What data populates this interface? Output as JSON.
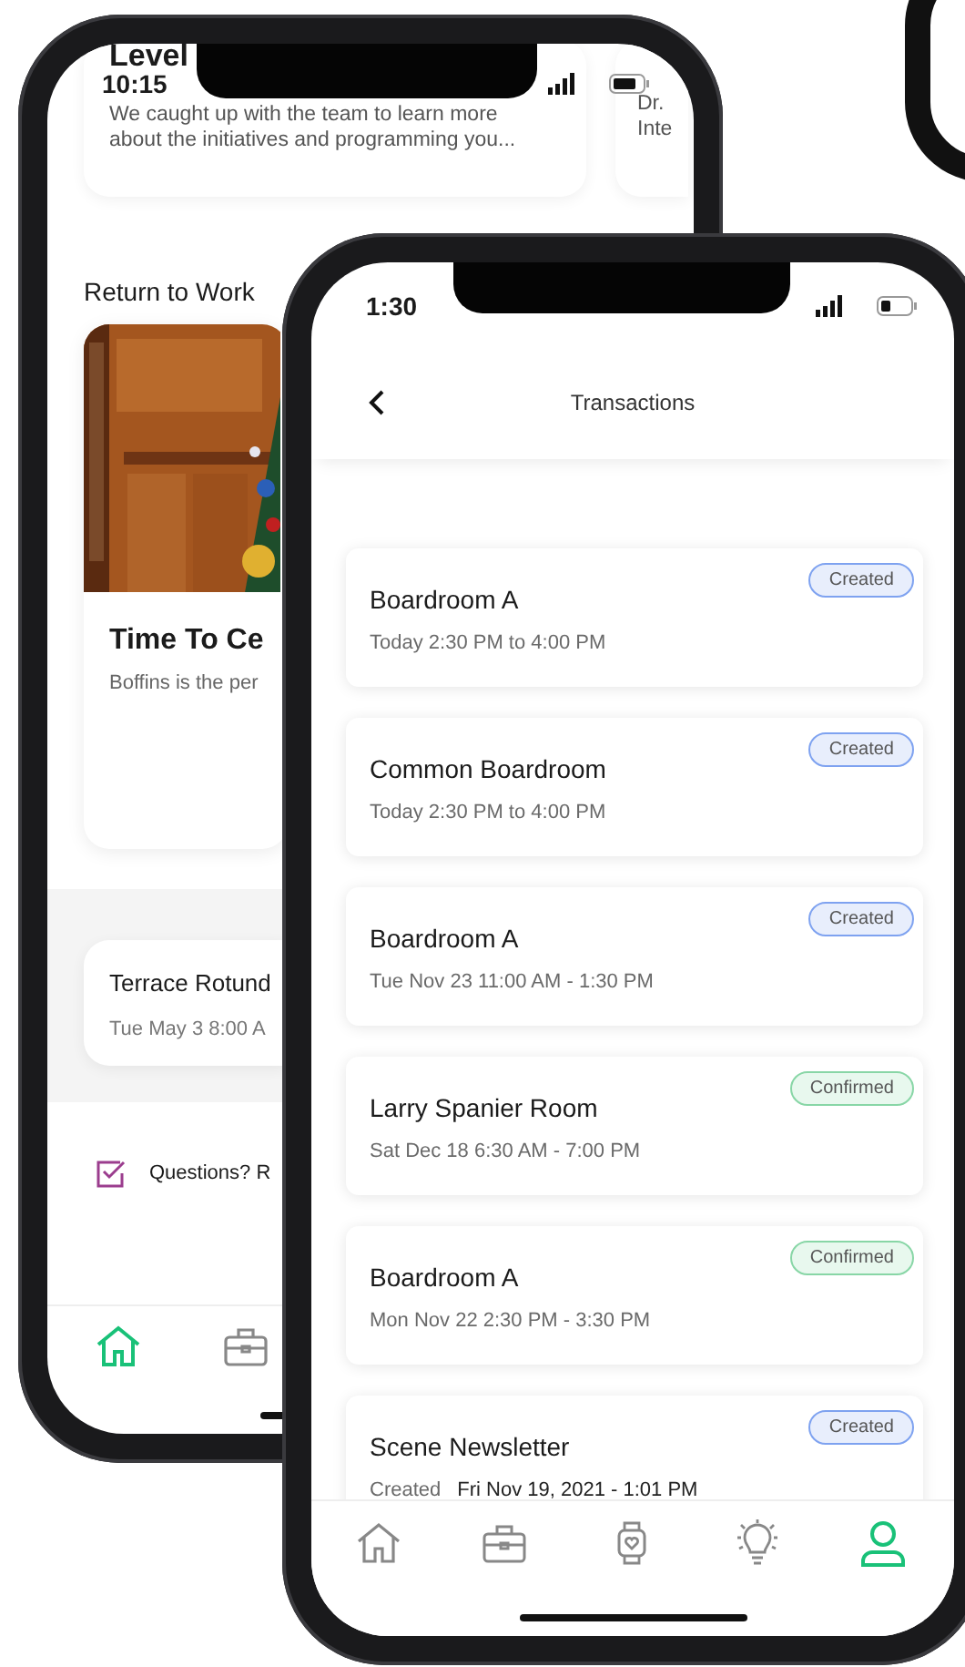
{
  "back_phone": {
    "status_time": "10:15",
    "featured": {
      "title": "Level",
      "summary": "We caught up with the team to learn more about the initiatives and programming you..."
    },
    "side_card": {
      "lines": [
        "Dr.",
        "Inte"
      ]
    },
    "section_title": "Return to Work",
    "article": {
      "kind": "picture",
      "title": "Time To Ce",
      "summary": "Boffins is the per"
    },
    "event": {
      "title": "Terrace Rotund",
      "time": "Tue May 3 8:00 A"
    },
    "help": {
      "text": "Questions? R"
    },
    "nav": [
      {
        "kind": "home",
        "selected": true
      },
      {
        "kind": "briefcase",
        "selected": false
      }
    ]
  },
  "front_phone": {
    "status_time": "1:30",
    "title": "Transactions",
    "transactions": [
      {
        "title": "Boardroom A",
        "time": "Today 2:30 PM to 4:00 PM",
        "status": "Created",
        "kind": "created"
      },
      {
        "title": "Common Boardroom",
        "time": "Today 2:30 PM to 4:00 PM",
        "status": "Created",
        "kind": "created"
      },
      {
        "title": "Boardroom A",
        "time": "Tue Nov 23 11:00 AM - 1:30 PM",
        "status": "Created",
        "kind": "created"
      },
      {
        "title": "Larry Spanier Room",
        "time": "Sat Dec 18 6:30 AM - 7:00 PM",
        "status": "Confirmed",
        "kind": "confirmed"
      },
      {
        "title": "Boardroom A",
        "time": "Mon Nov 22 2:30 PM - 3:30 PM",
        "status": "Confirmed",
        "kind": "confirmed"
      },
      {
        "title": "Scene Newsletter",
        "time_label": "Created",
        "time": "Fri Nov 19, 2021 - 1:01 PM",
        "status": "Created",
        "kind": "created"
      }
    ],
    "nav": [
      {
        "kind": "home",
        "selected": false
      },
      {
        "kind": "briefcase",
        "selected": false
      },
      {
        "kind": "watch",
        "selected": false
      },
      {
        "kind": "bulb",
        "selected": false
      },
      {
        "kind": "person",
        "selected": true
      }
    ]
  }
}
